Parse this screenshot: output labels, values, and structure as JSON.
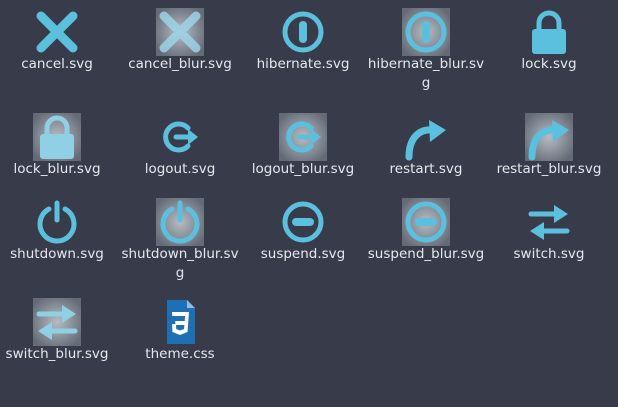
{
  "colors": {
    "background": "#383c4a",
    "icon_accent": "#5bc0de",
    "label_text": "#e4e8ee",
    "css_file_blue": "#1f6fb5"
  },
  "files": [
    {
      "name": "cancel.svg",
      "icon": "cancel-icon",
      "blur": false
    },
    {
      "name": "cancel_blur.svg",
      "icon": "cancel-blur-icon",
      "blur": true
    },
    {
      "name": "hibernate.svg",
      "icon": "hibernate-icon",
      "blur": false
    },
    {
      "name": "hibernate_blur.svg",
      "icon": "hibernate-blur-icon",
      "blur": true
    },
    {
      "name": "lock.svg",
      "icon": "lock-icon",
      "blur": false
    },
    {
      "name": "lock_blur.svg",
      "icon": "lock-blur-icon",
      "blur": true
    },
    {
      "name": "logout.svg",
      "icon": "logout-icon",
      "blur": false
    },
    {
      "name": "logout_blur.svg",
      "icon": "logout-blur-icon",
      "blur": true
    },
    {
      "name": "restart.svg",
      "icon": "restart-icon",
      "blur": false
    },
    {
      "name": "restart_blur.svg",
      "icon": "restart-blur-icon",
      "blur": true
    },
    {
      "name": "shutdown.svg",
      "icon": "shutdown-icon",
      "blur": false
    },
    {
      "name": "shutdown_blur.svg",
      "icon": "shutdown-blur-icon",
      "blur": true
    },
    {
      "name": "suspend.svg",
      "icon": "suspend-icon",
      "blur": false
    },
    {
      "name": "suspend_blur.svg",
      "icon": "suspend-blur-icon",
      "blur": true
    },
    {
      "name": "switch.svg",
      "icon": "switch-icon",
      "blur": false
    },
    {
      "name": "switch_blur.svg",
      "icon": "switch-blur-icon",
      "blur": true
    },
    {
      "name": "theme.css",
      "icon": "css-file-icon",
      "blur": false
    }
  ]
}
